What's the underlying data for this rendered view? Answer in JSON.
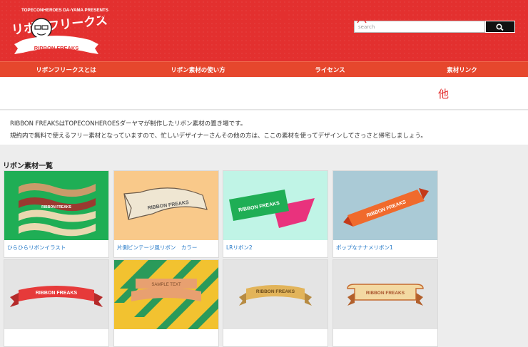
{
  "header": {
    "presents_text": "TOPECONHEROES DA-YAMA PRESENTS",
    "logo_script_text": "リボンフリークス",
    "logo_ribbon_text": "RIBBON FREAKS",
    "brand_color": "#e3302f"
  },
  "search": {
    "placeholder": "search",
    "value": "",
    "icon": "search-icon"
  },
  "nav": {
    "items": [
      {
        "label": "リボンフリークスとは"
      },
      {
        "label": "リボン素材の使い方"
      },
      {
        "label": "ライセンス"
      },
      {
        "label": "素材リンク"
      }
    ]
  },
  "ribbon_icons": {
    "items": [
      "ribbon-banner-icon",
      "ribbon-arch-icon",
      "ribbon-wave-icon",
      "ribbon-curl-icon",
      "ribbon-corner-icon",
      "ribbon-z-icon",
      "ribbon-bow-icon",
      "ribbon-bookmark-icon",
      "ribbon-badge-icon",
      "ribbon-flat-icon"
    ],
    "other_label": "他"
  },
  "intro": {
    "line1": "RIBBON FREAKSはTOPECONHEROESダーヤマが制作したリボン素材の置き場です。",
    "line2": "規約内で無料で使えるフリー素材となっていますので、忙しいデザイナーさんその他の方は、ここの素材を使ってデザインしてさっさと帰宅しましょう。"
  },
  "section": {
    "title": "リボン素材一覧"
  },
  "cards": [
    {
      "title": "ひらひらリボンイラスト",
      "ribbon_text": "RIBBON FREAKS",
      "bg": "#1fae55"
    },
    {
      "title": "片側ビンテージ風リボン　カラー",
      "ribbon_text": "RIBBON FREAKS",
      "bg": "#f9c98a"
    },
    {
      "title": "LRリボン2",
      "ribbon_text": "RIBBON FREAKS",
      "bg": "#c0f4e6"
    },
    {
      "title": "ポップなナナメリボン1",
      "ribbon_text": "RIBBON FREAKS",
      "bg": "#aacad6"
    },
    {
      "title": "",
      "ribbon_text": "RIBBON FREAKS",
      "bg": "#e4e4e4"
    },
    {
      "title": "",
      "ribbon_text": "SAMPLE TEXT",
      "bg": "#f2c230"
    },
    {
      "title": "",
      "ribbon_text": "RIBBON FREAKS",
      "bg": "#e4e4e4"
    },
    {
      "title": "",
      "ribbon_text": "RIBBON FREAKS",
      "bg": "#e4e4e4"
    }
  ]
}
